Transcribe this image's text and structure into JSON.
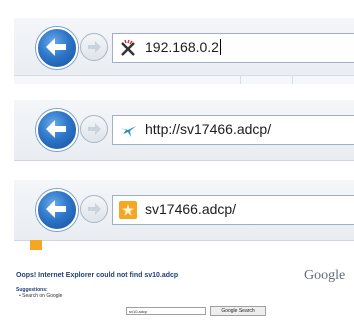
{
  "panels": [
    {
      "favicon": "broken-x-icon",
      "url": "192.168.0.2"
    },
    {
      "favicon": "bird-icon",
      "url": "http://sv17466.adcp/"
    },
    {
      "favicon": "orange-star-icon",
      "url": "sv17466.adcp/"
    }
  ],
  "error_page": {
    "message": "Oops! Internet Explorer could not find sv10.adcp",
    "logo": "Google",
    "suggestions_heading": "Suggestions:",
    "suggestion_item": "• Search on Google",
    "search_value": "sv10.adcp",
    "search_button": "Google Search"
  },
  "colors": {
    "accent": "#2d76c9",
    "favicon_orange": "#f5a623"
  }
}
